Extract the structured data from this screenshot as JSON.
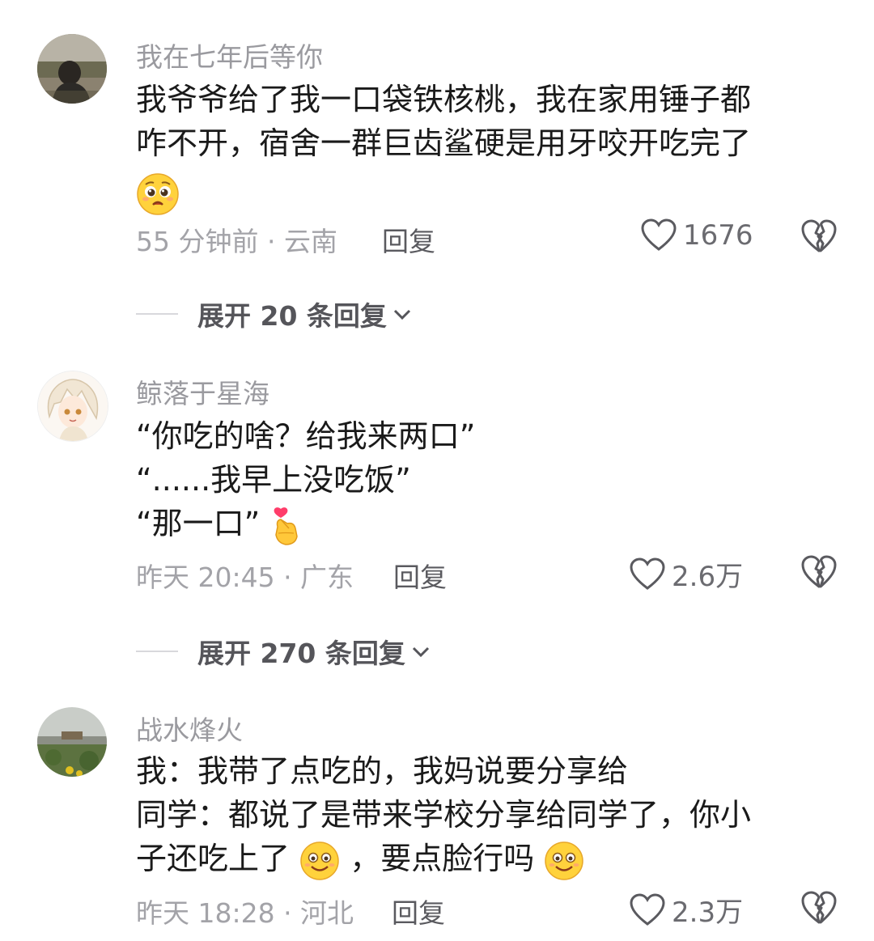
{
  "comments": [
    {
      "username": "我在七年后等你",
      "lines": [
        "我爷爷给了我一口袋铁核桃，我在家用锤子都",
        "咋不开，宿舍一群巨齿鲨硬是用牙咬开吃完了"
      ],
      "meta": "55 分钟前 · 云南",
      "reply_label": "回复",
      "likes": "1676",
      "emoji_icons": [
        "pleading-face-icon"
      ]
    },
    {
      "username": "鲸落于星海",
      "lines": [
        "“你吃的啥？给我来两口”",
        "“......我早上没吃饭”",
        "“那一口”"
      ],
      "meta": "昨天 20:45 · 广东",
      "reply_label": "回复",
      "likes": "2.6万",
      "emoji_icons": [
        "finger-heart-icon"
      ]
    },
    {
      "username": "战水烽火",
      "lines": [
        "我：我带了点吃的，我妈说要分享给",
        "同学：都说了是带来学校分享给同学了，你小",
        "子还吃上了",
        "，要点脸行吗"
      ],
      "meta": "昨天 18:28 · 河北",
      "reply_label": "回复",
      "likes": "2.3万",
      "emoji_icons": [
        "smiling-face-icon",
        "smiling-face-icon"
      ]
    }
  ],
  "expand_replies": [
    "展开 20 条回复",
    "展开 270 条回复"
  ],
  "colors": {
    "text": "#1a1a1a",
    "secondary": "#9a9a9f",
    "emoji_yellow": "#ffd23c"
  }
}
